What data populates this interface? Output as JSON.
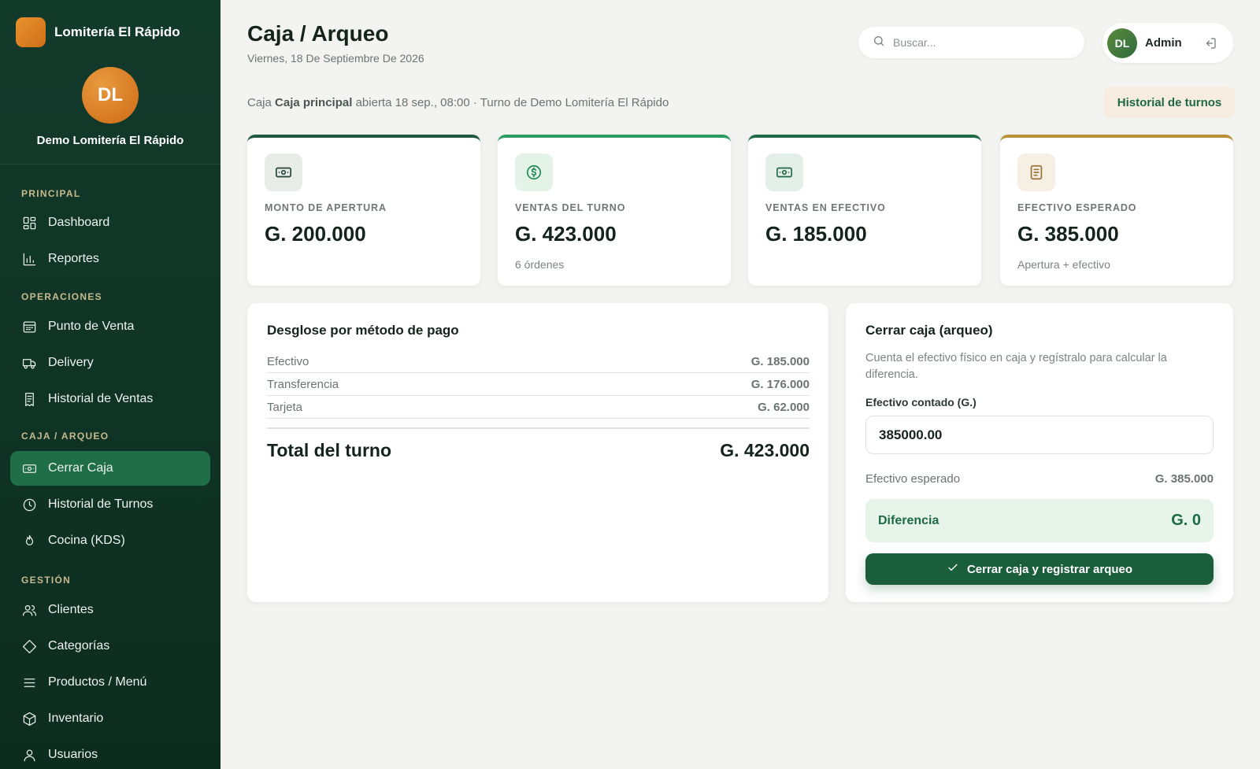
{
  "brand": {
    "name": "Lomitería El Rápido",
    "initials": "DL",
    "business": "Demo Lomitería El Rápido"
  },
  "sidebar": {
    "sections": [
      {
        "label": "PRINCIPAL",
        "items": [
          {
            "label": "Dashboard",
            "icon": "grid-icon"
          },
          {
            "label": "Reportes",
            "icon": "bar-chart-icon"
          }
        ]
      },
      {
        "label": "OPERACIONES",
        "items": [
          {
            "label": "Punto de Venta",
            "icon": "register-icon"
          },
          {
            "label": "Delivery",
            "icon": "truck-icon"
          },
          {
            "label": "Historial de Ventas",
            "icon": "receipt-icon"
          }
        ]
      },
      {
        "label": "CAJA / ARQUEO",
        "items": [
          {
            "label": "Cerrar Caja",
            "icon": "cash-icon",
            "active": true
          },
          {
            "label": "Historial de Turnos",
            "icon": "clock-icon"
          },
          {
            "label": "Cocina (KDS)",
            "icon": "flame-icon"
          }
        ]
      },
      {
        "label": "GESTIÓN",
        "items": [
          {
            "label": "Clientes",
            "icon": "users-icon"
          },
          {
            "label": "Categorías",
            "icon": "tag-icon"
          },
          {
            "label": "Productos / Menú",
            "icon": "menu-icon"
          },
          {
            "label": "Inventario",
            "icon": "box-icon"
          },
          {
            "label": "Usuarios",
            "icon": "user-icon"
          }
        ]
      }
    ]
  },
  "header": {
    "title": "Caja / Arqueo",
    "date": "Viernes, 18 De Septiembre De 2026",
    "search_placeholder": "Buscar...",
    "user": {
      "initials": "DL",
      "name": "Admin"
    }
  },
  "shift": {
    "prefix": "Caja",
    "register": "Caja principal",
    "suffix": "abierta 18 sep., 08:00 · Turno de Demo Lomitería El Rápido",
    "history_button": "Historial de turnos"
  },
  "stats": [
    {
      "label": "MONTO DE APERTURA",
      "value": "G. 200.000",
      "sub": "",
      "icon": "cash-icon",
      "accent": "#1f5a3e"
    },
    {
      "label": "VENTAS DEL TURNO",
      "value": "G. 423.000",
      "sub": "6 órdenes",
      "icon": "dollar-circle-icon",
      "accent": "#2e9a63"
    },
    {
      "label": "VENTAS EN EFECTIVO",
      "value": "G. 185.000",
      "sub": "",
      "icon": "cash-icon",
      "accent": "#1e6a45"
    },
    {
      "label": "EFECTIVO ESPERADO",
      "value": "G. 385.000",
      "sub": "Apertura + efectivo",
      "icon": "document-icon",
      "accent": "#b8913a"
    }
  ],
  "breakdown": {
    "title": "Desglose por método de pago",
    "rows": [
      {
        "method": "Efectivo",
        "amount": "G. 185.000"
      },
      {
        "method": "Transferencia",
        "amount": "G. 176.000"
      },
      {
        "method": "Tarjeta",
        "amount": "G. 62.000"
      }
    ],
    "total_label": "Total del turno",
    "total_value": "G. 423.000"
  },
  "close": {
    "title": "Cerrar caja (arqueo)",
    "description": "Cuenta el efectivo físico en caja y regístralo para calcular la diferencia.",
    "field_label": "Efectivo contado (G.)",
    "field_value": "385000.00",
    "expected_label": "Efectivo esperado",
    "expected_value": "G. 385.000",
    "difference_label": "Diferencia",
    "difference_value": "G. 0",
    "submit_label": "Cerrar caja y registrar arqueo"
  }
}
